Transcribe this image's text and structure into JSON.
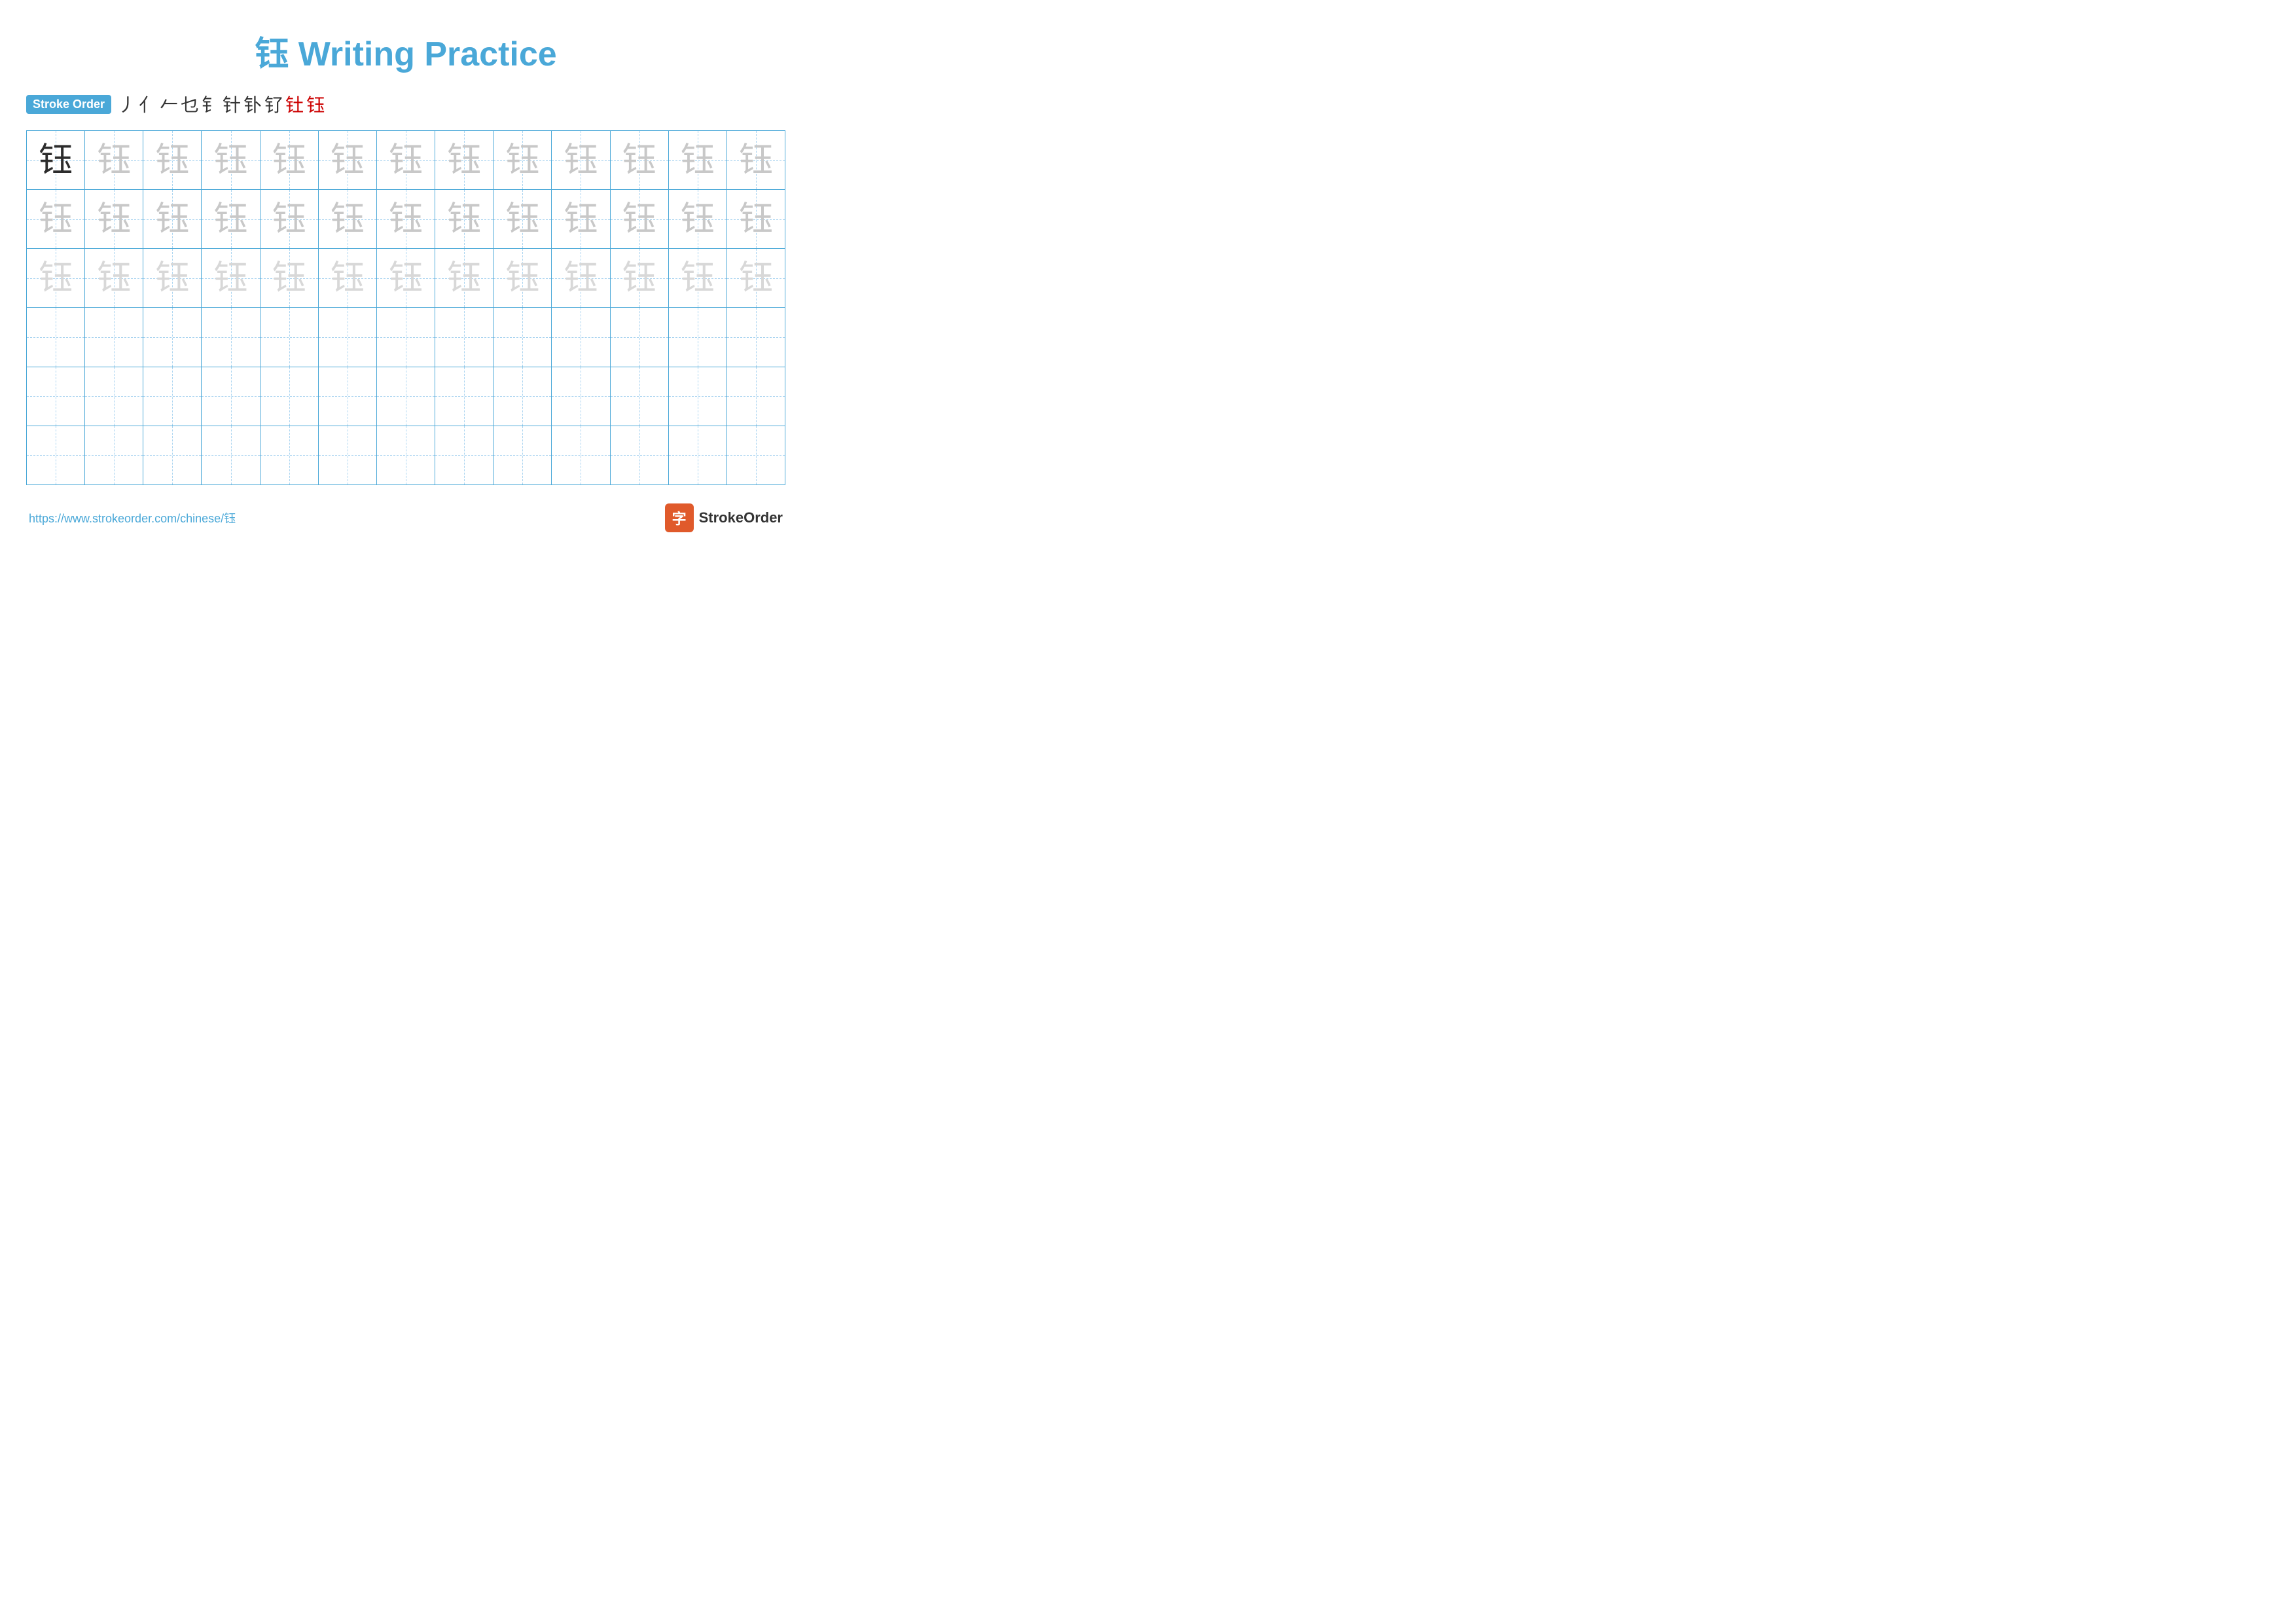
{
  "title": "钰 Writing Practice",
  "stroke_order": {
    "badge": "Stroke Order",
    "strokes": [
      "丿",
      "亻",
      "𠂉",
      "乜",
      "钅",
      "钅̀",
      "钰̀",
      "钰̈",
      "钰̃",
      "钰"
    ]
  },
  "character": "钰",
  "url": "https://www.strokeorder.com/chinese/钰",
  "brand": "StrokeOrder",
  "grid": {
    "cols": 13,
    "rows": 6,
    "row_data": [
      {
        "type": "dark_then_light1"
      },
      {
        "type": "light1"
      },
      {
        "type": "light2"
      },
      {
        "type": "empty"
      },
      {
        "type": "empty"
      },
      {
        "type": "empty"
      }
    ]
  }
}
